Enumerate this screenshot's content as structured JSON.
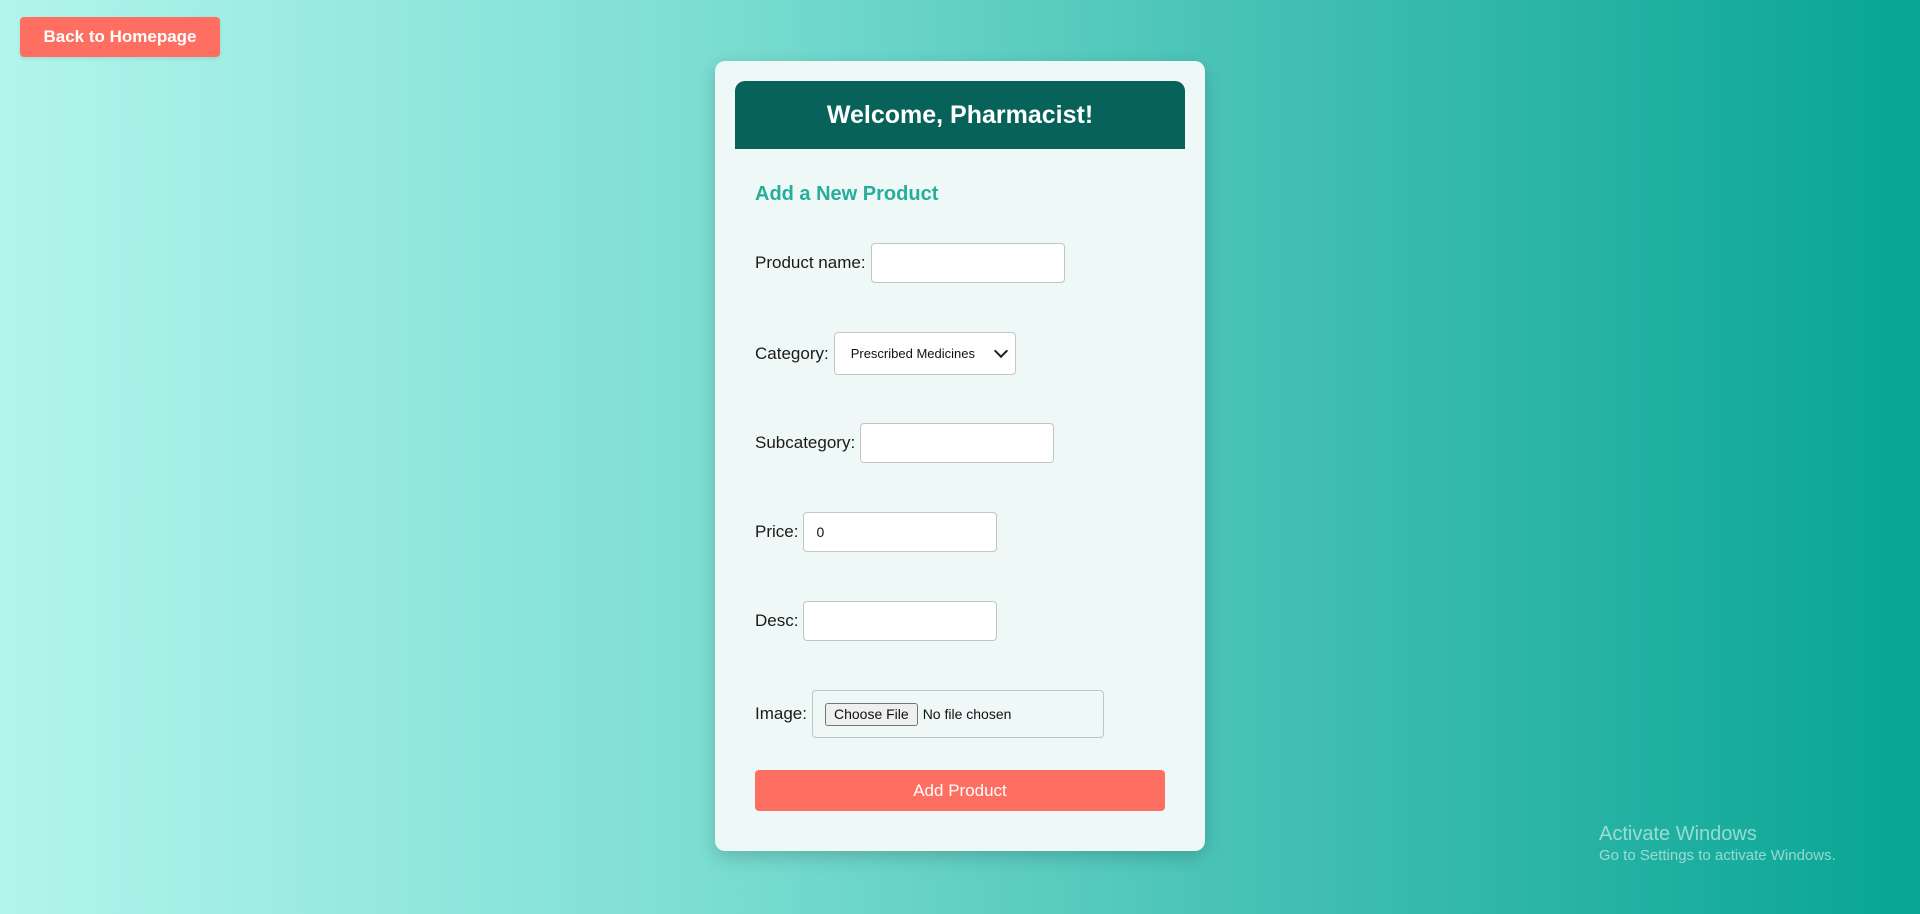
{
  "nav": {
    "back_label": "Back to Homepage"
  },
  "card": {
    "header_title": "Welcome, Pharmacist!",
    "form_title": "Add a New Product"
  },
  "form": {
    "product_name": {
      "label": "Product name:",
      "value": ""
    },
    "category": {
      "label": "Category:",
      "selected": "Prescribed Medicines"
    },
    "subcategory": {
      "label": "Subcategory:",
      "value": ""
    },
    "price": {
      "label": "Price:",
      "value": "0"
    },
    "desc": {
      "label": "Desc:",
      "value": ""
    },
    "image": {
      "label": "Image:",
      "button_label": "Choose File",
      "status": "No file chosen"
    },
    "submit_label": "Add Product"
  },
  "watermark": {
    "line1": "Activate Windows",
    "line2": "Go to Settings to activate Windows."
  },
  "colors": {
    "accent": "#ff6f61",
    "header": "#07625a",
    "title": "#26ad9c"
  }
}
